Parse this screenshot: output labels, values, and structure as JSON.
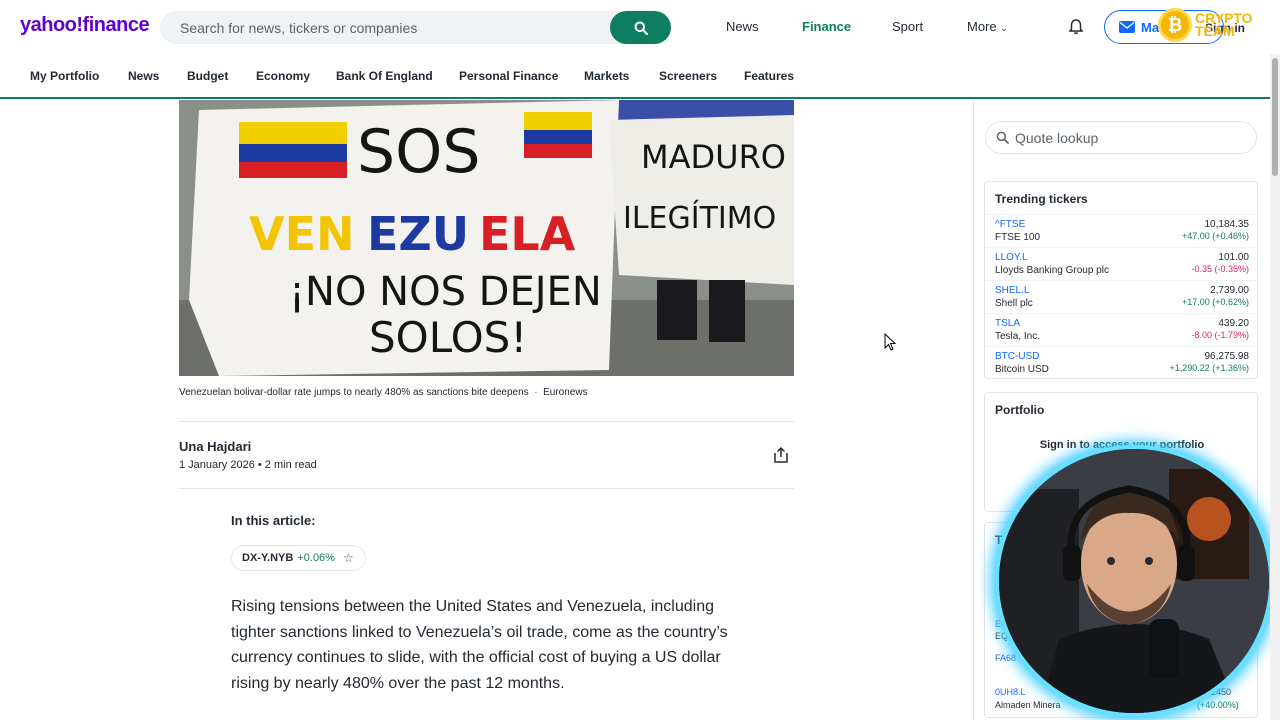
{
  "header": {
    "logo": "yahoo!finance",
    "search_placeholder": "Search for news, tickers or companies",
    "nav": [
      "News",
      "Finance",
      "Sport",
      "More"
    ],
    "mail_label": "Mail",
    "signin_label": "Sign in",
    "crypto_badge": [
      "CRYPTO",
      "TEAM"
    ]
  },
  "subnav": [
    "My Portfolio",
    "News",
    "Budget",
    "Economy",
    "Bank Of England",
    "Personal Finance",
    "Markets",
    "Screeners",
    "Features"
  ],
  "article": {
    "hero_signs": {
      "left": "SOS VENEZUELA ¡NO NOS DEJEN SOLOS!",
      "right": "MADURO ILEGÍTIMO"
    },
    "caption": "Venezuelan bolivar-dollar rate jumps to nearly 480% as sanctions bite deepens",
    "caption_source": "Euronews",
    "author": "Una Hajdari",
    "date": "1 January 2026 • 2 min read",
    "in_article_label": "In this article:",
    "ticker": {
      "symbol": "DX-Y.NYB",
      "change": "+0.06%"
    },
    "body": "Rising tensions between the United States and Venezuela, including tighter sanctions linked to Venezuela’s oil trade, come as the country’s currency continues to slide, with the official cost of buying a US dollar rising by nearly 480% over the past 12 months."
  },
  "sidebar": {
    "quote_placeholder": "Quote lookup",
    "trending_title": "Trending tickers",
    "tickers": [
      {
        "symbol": "^FTSE",
        "name": "FTSE 100",
        "price": "10,184.35",
        "change": "+47.00 (+0.46%)",
        "dir": "up"
      },
      {
        "symbol": "LLOY.L",
        "name": "Lloyds Banking Group plc",
        "price": "101.00",
        "change": "-0.35 (-0.35%)",
        "dir": "dn"
      },
      {
        "symbol": "SHEL.L",
        "name": "Shell plc",
        "price": "2,739.00",
        "change": "+17.00 (+0.62%)",
        "dir": "up"
      },
      {
        "symbol": "TSLA",
        "name": "Tesla, Inc.",
        "price": "439.20",
        "change": "-8.00 (-1.79%)",
        "dir": "dn"
      },
      {
        "symbol": "BTC-USD",
        "name": "Bitcoin USD",
        "price": "96,275.98",
        "change": "+1,290.22 (+1.36%)",
        "dir": "up"
      }
    ],
    "portfolio_title": "Portfolio",
    "portfolio_signin": "Sign in to access your portfolio",
    "partial": {
      "ec": "EC",
      "eq": "EQ",
      "fa": "FA68",
      "ouhb": "0UH8.L",
      "almaden": "Almaden Minera",
      "pct": "(+40.00%)",
      "price": "2450",
      "t": "T"
    }
  }
}
